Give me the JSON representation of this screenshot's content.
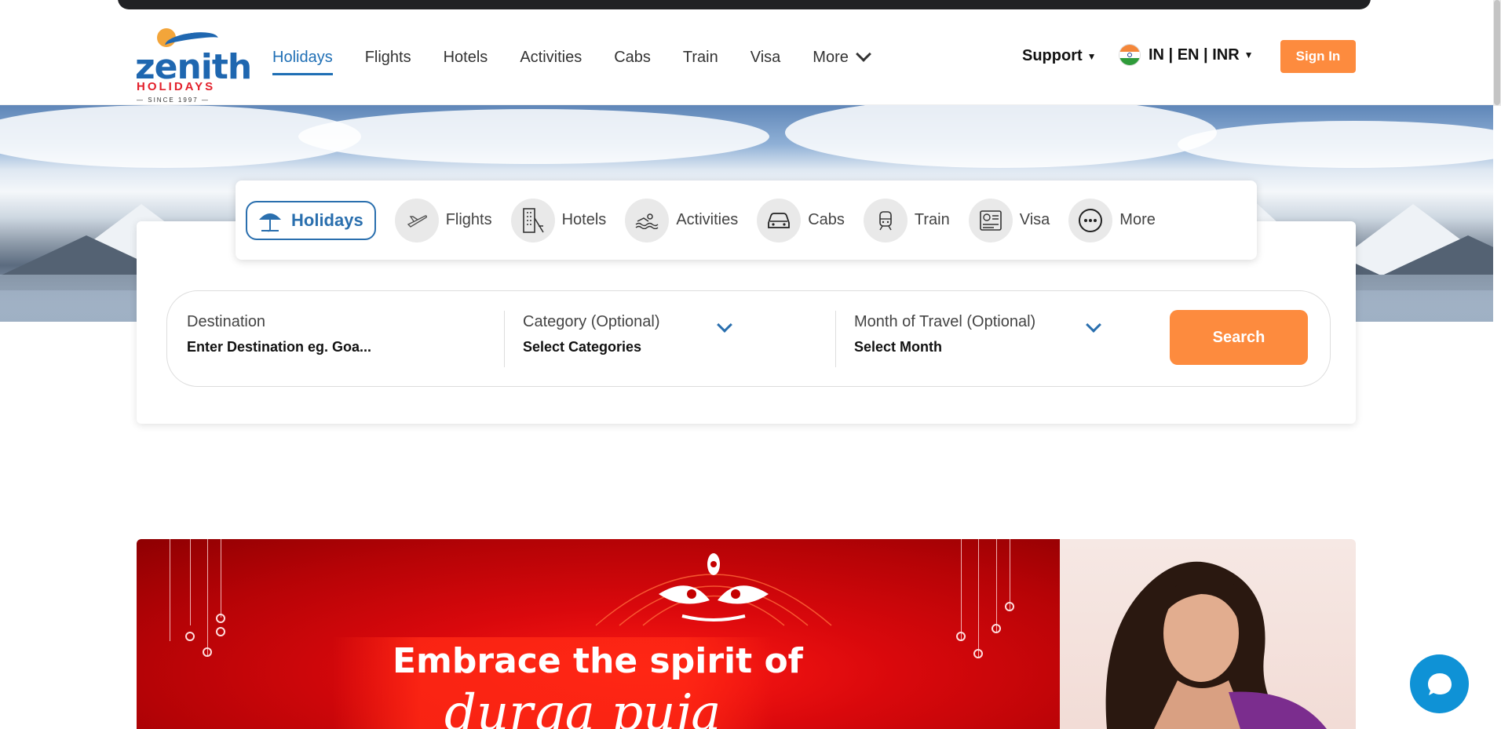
{
  "brand": {
    "name": "zenith",
    "tagline": "HOLIDAYS",
    "since": "SINCE 1997",
    "accent": "#1f6fb5",
    "cta": "#fd8b3e"
  },
  "nav": {
    "items": [
      "Holidays",
      "Flights",
      "Hotels",
      "Activities",
      "Cabs",
      "Train",
      "Visa"
    ],
    "more_label": "More",
    "active": "Holidays"
  },
  "header": {
    "support_label": "Support",
    "locale_label": "IN | EN | INR",
    "signin_label": "Sign In"
  },
  "tabs": {
    "items": [
      {
        "label": "Holidays",
        "icon": "umbrella-icon"
      },
      {
        "label": "Flights",
        "icon": "plane-icon"
      },
      {
        "label": "Hotels",
        "icon": "building-icon"
      },
      {
        "label": "Activities",
        "icon": "swim-icon"
      },
      {
        "label": "Cabs",
        "icon": "car-icon"
      },
      {
        "label": "Train",
        "icon": "train-icon"
      },
      {
        "label": "Visa",
        "icon": "passport-icon"
      },
      {
        "label": "More",
        "icon": "more-icon"
      }
    ]
  },
  "search": {
    "destination_label": "Destination",
    "destination_placeholder": "Enter Destination eg. Goa...",
    "category_label": "Category (Optional)",
    "category_value": "Select Categories",
    "month_label": "Month of Travel (Optional)",
    "month_value": "Select Month",
    "button_label": "Search"
  },
  "banner": {
    "line1": "Embrace the spirit of",
    "line2": "durga puja"
  }
}
